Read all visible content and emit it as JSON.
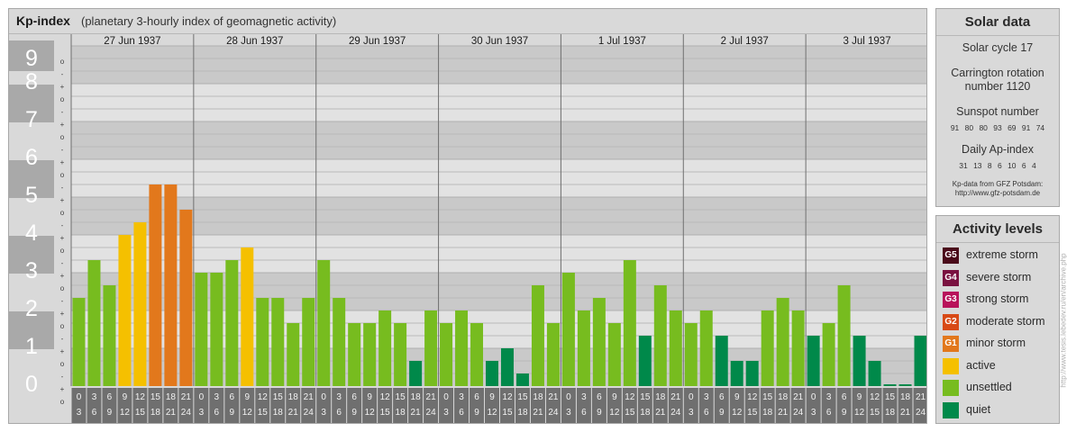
{
  "chart_data": {
    "type": "bar",
    "title": "Kp-index",
    "subtitle": "(planetary 3-hourly index of geomagnetic activity)",
    "y_ticks": [
      "0",
      "1",
      "2",
      "3",
      "4",
      "5",
      "6",
      "7",
      "8",
      "9"
    ],
    "sub_tick_labels": [
      "o",
      "+",
      "-"
    ],
    "ylim": [
      0,
      9
    ],
    "days": [
      "27 Jun 1937",
      "28 Jun 1937",
      "29 Jun 1937",
      "30 Jun 1937",
      "1 Jul 1937",
      "2 Jul 1937",
      "3 Jul 1937"
    ],
    "interval_labels": [
      [
        "0",
        "3"
      ],
      [
        "3",
        "6"
      ],
      [
        "6",
        "9"
      ],
      [
        "9",
        "12"
      ],
      [
        "12",
        "15"
      ],
      [
        "15",
        "18"
      ],
      [
        "18",
        "21"
      ],
      [
        "21",
        "24"
      ]
    ],
    "values": [
      2.333,
      3.333,
      2.667,
      4.0,
      4.333,
      5.333,
      5.333,
      4.667,
      3.0,
      3.0,
      3.333,
      3.667,
      2.333,
      2.333,
      1.667,
      2.333,
      3.333,
      2.333,
      1.667,
      1.667,
      2.0,
      1.667,
      0.667,
      2.0,
      1.667,
      2.0,
      1.667,
      0.667,
      1.0,
      0.333,
      2.667,
      1.667,
      3.0,
      2.0,
      2.333,
      1.667,
      3.333,
      1.333,
      2.667,
      2.0,
      1.667,
      2.0,
      1.333,
      0.667,
      0.667,
      2.0,
      2.333,
      2.0,
      1.333,
      1.667,
      2.667,
      1.333,
      0.667,
      0.0,
      0.0,
      1.333
    ],
    "colors": {
      "extreme_storm": "#4a0a1a",
      "severe_storm": "#7a1240",
      "strong_storm": "#b8125a",
      "moderate_storm": "#d84a16",
      "minor_storm": "#e2781c",
      "active": "#f5c000",
      "unsettled": "#77bc1f",
      "quiet": "#00894a"
    },
    "grid": true
  },
  "solar": {
    "title": "Solar data",
    "cycle": "Solar cycle 17",
    "carrington_line1": "Carrington rotation",
    "carrington_line2": "number 1120",
    "sunspot_title": "Sunspot number",
    "sunspot_values": "91 80 80 93 69 91 74",
    "ap_title": "Daily Ap-index",
    "ap_values": "31 13 8 6 10 6 4",
    "credit_line1": "Kp-data from GFZ Potsdam:",
    "credit_line2": "http://www.gfz-potsdam.de"
  },
  "legend": {
    "title": "Activity levels",
    "items": [
      {
        "code": "G5",
        "label": "extreme storm",
        "color": "#4a0a1a"
      },
      {
        "code": "G4",
        "label": "severe storm",
        "color": "#7a1240"
      },
      {
        "code": "G3",
        "label": "strong storm",
        "color": "#b8125a"
      },
      {
        "code": "G2",
        "label": "moderate storm",
        "color": "#d84a16"
      },
      {
        "code": "G1",
        "label": "minor storm",
        "color": "#e2781c"
      },
      {
        "code": "",
        "label": "active",
        "color": "#f5c000"
      },
      {
        "code": "",
        "label": "unsettled",
        "color": "#77bc1f"
      },
      {
        "code": "",
        "label": "quiet",
        "color": "#00894a"
      }
    ]
  },
  "watermark": "http://www.tesis.lebedev.ru/en/archive.php"
}
